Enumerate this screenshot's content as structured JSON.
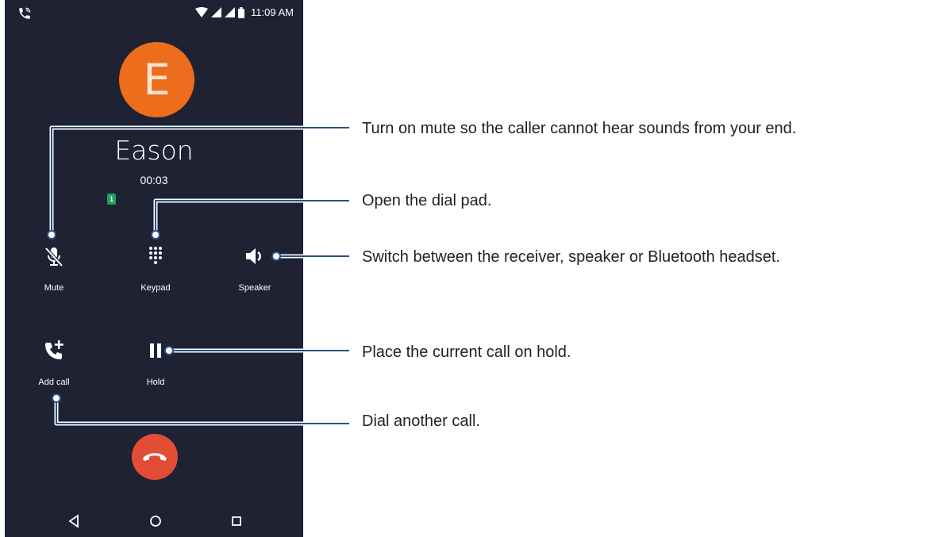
{
  "status_bar": {
    "time": "11:09 AM"
  },
  "caller": {
    "initial": "E",
    "name": "Eason",
    "duration": "00:03",
    "sim": "1"
  },
  "controls": {
    "mute": "Mute",
    "keypad": "Keypad",
    "speaker": "Speaker",
    "add_call": "Add call",
    "hold": "Hold"
  },
  "callouts": {
    "mute": "Turn on mute so the caller cannot hear sounds from your end.",
    "keypad": "Open the dial pad.",
    "speaker": "Switch between the receiver, speaker or Bluetooth headset.",
    "hold": "Place the current call on hold.",
    "add_call": "Dial another call."
  },
  "colors": {
    "screen_bg": "#1f2233",
    "avatar": "#ee6d1d",
    "end_call": "#e34c35",
    "callout_line": "#2d4f86",
    "sim_badge": "#1aa260"
  },
  "icons": [
    "phone-call-icon",
    "wifi-icon",
    "signal-icon",
    "battery-icon",
    "mic-off-icon",
    "dialpad-icon",
    "volume-icon",
    "add-call-icon",
    "pause-icon",
    "end-call-icon",
    "back-icon",
    "home-icon",
    "recents-icon"
  ]
}
